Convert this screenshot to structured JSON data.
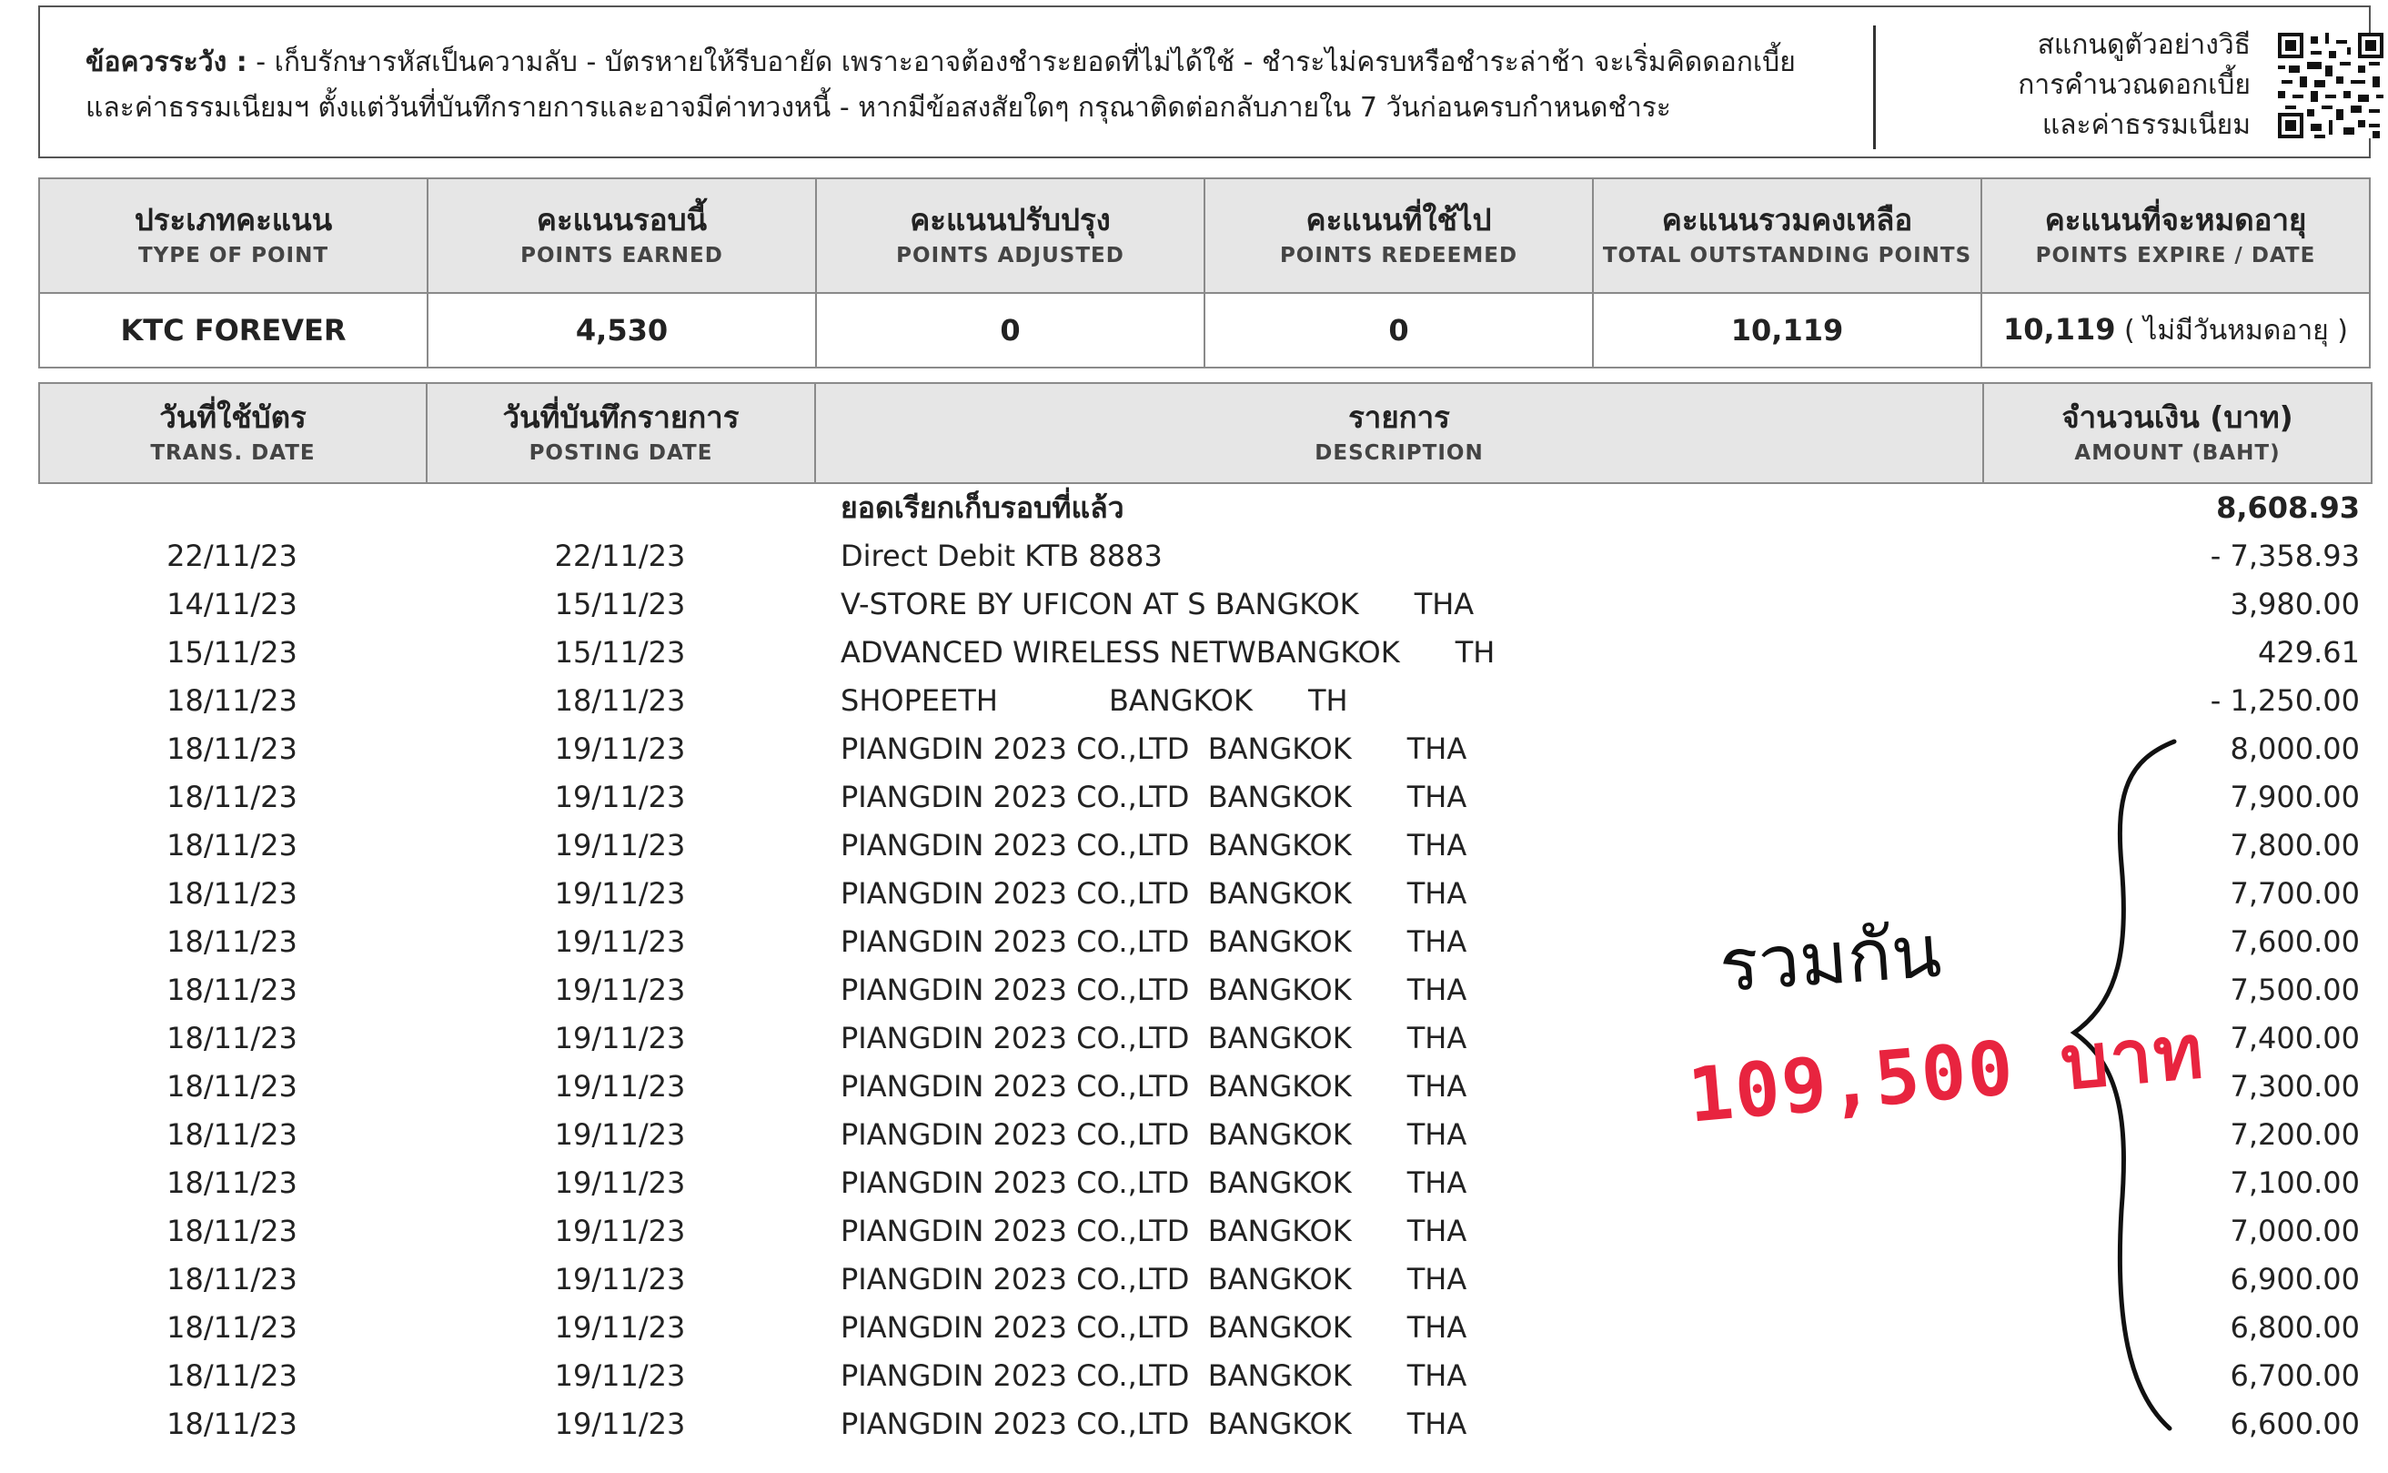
{
  "notice": {
    "heading": "ข้อควรระวัง :",
    "line1_rest": " - เก็บรักษารหัสเป็นความลับ - บัตรหายให้รีบอายัด เพราะอาจต้องชำระยอดที่ไม่ได้ใช้ - ชำระไม่ครบหรือชำระล่าช้า จะเริ่มคิดดอกเบี้ย",
    "line2": "และค่าธรรมเนียมฯ ตั้งแต่วันที่บันทึกรายการและอาจมีค่าทวงหนี้ - หากมีข้อสงสัยใดๆ กรุณาติดต่อกลับภายใน 7 วันก่อนครบกำหนดชำระ",
    "scan_line1": "สแกนดูตัวอย่างวิธี",
    "scan_line2": "การคำนวณดอกเบี้ย",
    "scan_line3": "และค่าธรรมเนียม"
  },
  "points": {
    "headers": [
      {
        "th": "ประเภทคะแนน",
        "en": "TYPE OF POINT"
      },
      {
        "th": "คะแนนรอบนี้",
        "en": "POINTS EARNED"
      },
      {
        "th": "คะแนนปรับปรุง",
        "en": "POINTS ADJUSTED"
      },
      {
        "th": "คะแนนที่ใช้ไป",
        "en": "POINTS REDEEMED"
      },
      {
        "th": "คะแนนรวมคงเหลือ",
        "en": "TOTAL OUTSTANDING POINTS"
      },
      {
        "th": "คะแนนที่จะหมดอายุ",
        "en": "POINTS EXPIRE / DATE"
      }
    ],
    "values": {
      "type": "KTC FOREVER",
      "earned": "4,530",
      "adjusted": "0",
      "redeemed": "0",
      "outstanding": "10,119",
      "expire_value": "10,119",
      "expire_note": " ( ไม่มีวันหมดอายุ )"
    }
  },
  "transactions": {
    "headers": [
      {
        "th": "วันที่ใช้บัตร",
        "en": "TRANS. DATE"
      },
      {
        "th": "วันที่บันทึกรายการ",
        "en": "POSTING DATE"
      },
      {
        "th": "รายการ",
        "en": "DESCRIPTION"
      },
      {
        "th": "จำนวนเงิน (บาท)",
        "en": "AMOUNT (BAHT)"
      }
    ],
    "previous_balance_label": "ยอดเรียกเก็บรอบที่แล้ว",
    "previous_balance_amount": "8,608.93",
    "rows": [
      {
        "tdate": "22/11/23",
        "pdate": "22/11/23",
        "desc": "Direct Debit KTB 8883",
        "amount": "- 7,358.93"
      },
      {
        "tdate": "14/11/23",
        "pdate": "15/11/23",
        "desc": "V-STORE BY UFICON AT S BANGKOK      THA",
        "amount": "3,980.00"
      },
      {
        "tdate": "15/11/23",
        "pdate": "15/11/23",
        "desc": "ADVANCED WIRELESS NETWBANGKOK      TH",
        "amount": "429.61"
      },
      {
        "tdate": "18/11/23",
        "pdate": "18/11/23",
        "desc": "SHOPEETH            BANGKOK      TH",
        "amount": "- 1,250.00"
      },
      {
        "tdate": "18/11/23",
        "pdate": "19/11/23",
        "desc": "PIANGDIN 2023 CO.,LTD  BANGKOK      THA",
        "amount": "8,000.00"
      },
      {
        "tdate": "18/11/23",
        "pdate": "19/11/23",
        "desc": "PIANGDIN 2023 CO.,LTD  BANGKOK      THA",
        "amount": "7,900.00"
      },
      {
        "tdate": "18/11/23",
        "pdate": "19/11/23",
        "desc": "PIANGDIN 2023 CO.,LTD  BANGKOK      THA",
        "amount": "7,800.00"
      },
      {
        "tdate": "18/11/23",
        "pdate": "19/11/23",
        "desc": "PIANGDIN 2023 CO.,LTD  BANGKOK      THA",
        "amount": "7,700.00"
      },
      {
        "tdate": "18/11/23",
        "pdate": "19/11/23",
        "desc": "PIANGDIN 2023 CO.,LTD  BANGKOK      THA",
        "amount": "7,600.00"
      },
      {
        "tdate": "18/11/23",
        "pdate": "19/11/23",
        "desc": "PIANGDIN 2023 CO.,LTD  BANGKOK      THA",
        "amount": "7,500.00"
      },
      {
        "tdate": "18/11/23",
        "pdate": "19/11/23",
        "desc": "PIANGDIN 2023 CO.,LTD  BANGKOK      THA",
        "amount": "7,400.00"
      },
      {
        "tdate": "18/11/23",
        "pdate": "19/11/23",
        "desc": "PIANGDIN 2023 CO.,LTD  BANGKOK      THA",
        "amount": "7,300.00"
      },
      {
        "tdate": "18/11/23",
        "pdate": "19/11/23",
        "desc": "PIANGDIN 2023 CO.,LTD  BANGKOK      THA",
        "amount": "7,200.00"
      },
      {
        "tdate": "18/11/23",
        "pdate": "19/11/23",
        "desc": "PIANGDIN 2023 CO.,LTD  BANGKOK      THA",
        "amount": "7,100.00"
      },
      {
        "tdate": "18/11/23",
        "pdate": "19/11/23",
        "desc": "PIANGDIN 2023 CO.,LTD  BANGKOK      THA",
        "amount": "7,000.00"
      },
      {
        "tdate": "18/11/23",
        "pdate": "19/11/23",
        "desc": "PIANGDIN 2023 CO.,LTD  BANGKOK      THA",
        "amount": "6,900.00"
      },
      {
        "tdate": "18/11/23",
        "pdate": "19/11/23",
        "desc": "PIANGDIN 2023 CO.,LTD  BANGKOK      THA",
        "amount": "6,800.00"
      },
      {
        "tdate": "18/11/23",
        "pdate": "19/11/23",
        "desc": "PIANGDIN 2023 CO.,LTD  BANGKOK      THA",
        "amount": "6,700.00"
      },
      {
        "tdate": "18/11/23",
        "pdate": "19/11/23",
        "desc": "PIANGDIN 2023 CO.,LTD  BANGKOK      THA",
        "amount": "6,600.00"
      }
    ]
  },
  "annotation": {
    "label": "รวมกัน",
    "total": "109,500 บาท",
    "total_color": "#e8243f"
  }
}
